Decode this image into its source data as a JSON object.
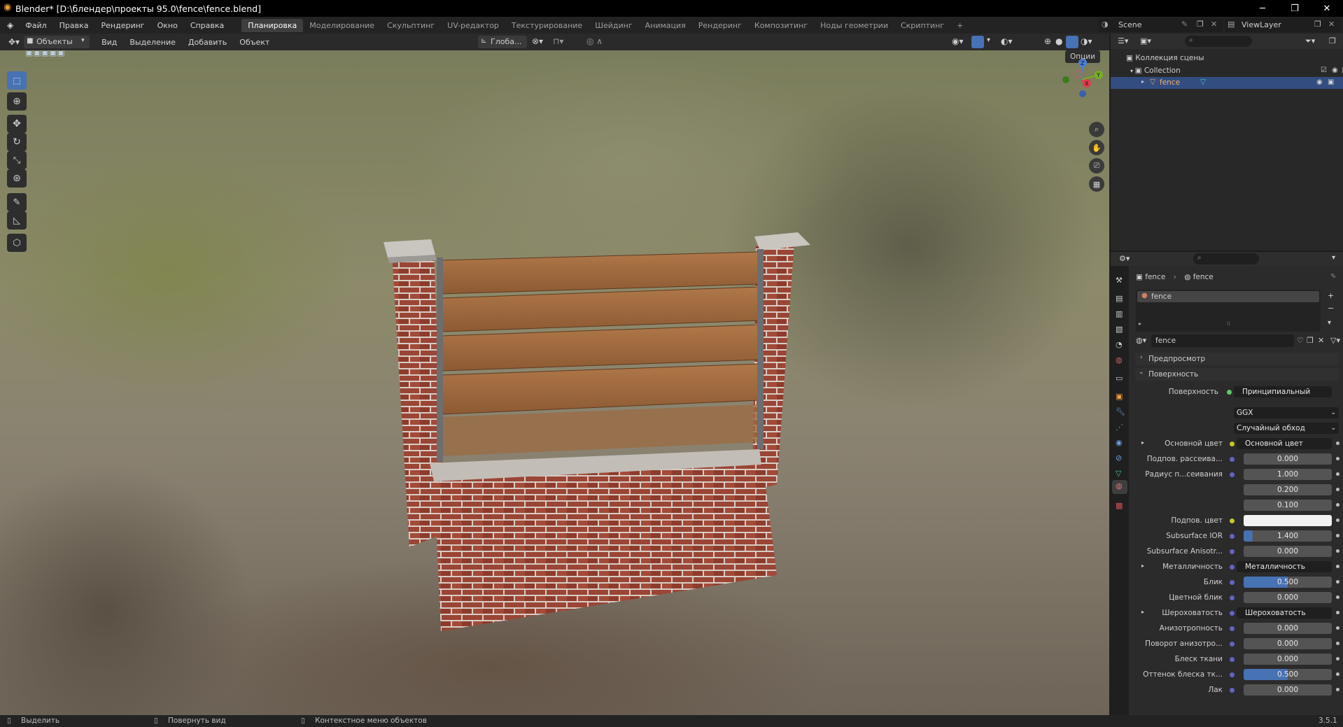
{
  "window": {
    "title": "Blender* [D:\\блендер\\проекты 95.0\\fence\\fence.blend]",
    "minimize": "─",
    "maximize": "❐",
    "close": "✕"
  },
  "menu": [
    "Файл",
    "Правка",
    "Рендеринг",
    "Окно",
    "Справка"
  ],
  "workspaces": [
    "Планировка",
    "Моделирование",
    "Скульптинг",
    "UV-редактор",
    "Текстурирование",
    "Шейдинг",
    "Анимация",
    "Рендеринг",
    "Композитинг",
    "Ноды геометрии",
    "Скриптинг",
    "+"
  ],
  "active_workspace": "Планировка",
  "scene": {
    "name": "Scene",
    "view_layer": "ViewLayer"
  },
  "viewport_header": {
    "mode": "Объекты",
    "menus": [
      "Вид",
      "Выделение",
      "Добавить",
      "Объект"
    ],
    "orientation": "Глоба...",
    "options": "Опции"
  },
  "gizmo": {
    "x": "X",
    "y": "Y",
    "z": "Z"
  },
  "outliner": {
    "root": "Коллекция сцены",
    "collection": "Collection",
    "object": "fence"
  },
  "properties": {
    "breadcrumb": [
      "fence",
      "fence"
    ],
    "material_slot": "fence",
    "material_name": "fence",
    "panels": {
      "preview": "Предпросмотр",
      "surface": "Поверхность"
    },
    "surface_shader": {
      "label": "Поверхность",
      "value": "Принципиальный BSDF"
    },
    "distribution": "GGX",
    "subsurface_method": "Случайный обход",
    "rows": [
      {
        "label": "Основной цвет",
        "value": "Основной цвет",
        "type": "socket",
        "dot": "y",
        "expand": true
      },
      {
        "label": "Подпов. рассеива...",
        "value": "0.000",
        "type": "num",
        "dot": "b"
      },
      {
        "label": "Радиус п...сеивания",
        "value": "1.000",
        "type": "num",
        "dot": "b"
      },
      {
        "label": "",
        "value": "0.200",
        "type": "num"
      },
      {
        "label": "",
        "value": "0.100",
        "type": "num"
      },
      {
        "label": "Подпов. цвет",
        "value": "",
        "type": "color",
        "dot": "y"
      },
      {
        "label": "Subsurface IOR",
        "value": "1.400",
        "type": "num",
        "dot": "b",
        "fill": 0.1
      },
      {
        "label": "Subsurface Anisotr...",
        "value": "0.000",
        "type": "num",
        "dot": "b"
      },
      {
        "label": "Металличность",
        "value": "Металличность",
        "type": "socket",
        "dot": "b",
        "expand": true
      },
      {
        "label": "Блик",
        "value": "0.500",
        "type": "num",
        "dot": "b",
        "fill": 0.5
      },
      {
        "label": "Цветной блик",
        "value": "0.000",
        "type": "num",
        "dot": "b"
      },
      {
        "label": "Шероховатость",
        "value": "Шероховатость",
        "type": "socket",
        "dot": "b",
        "expand": true
      },
      {
        "label": "Анизотропность",
        "value": "0.000",
        "type": "num",
        "dot": "b"
      },
      {
        "label": "Поворот анизотро...",
        "value": "0.000",
        "type": "num",
        "dot": "b"
      },
      {
        "label": "Блеск ткани",
        "value": "0.000",
        "type": "num",
        "dot": "b"
      },
      {
        "label": "Оттенок блеска тк...",
        "value": "0.500",
        "type": "num",
        "dot": "b",
        "fill": 0.5
      },
      {
        "label": "Лак",
        "value": "0.000",
        "type": "num",
        "dot": "b"
      }
    ]
  },
  "statusbar": {
    "select": "Выделить",
    "rotate": "Повернуть вид",
    "context": "Контекстное меню объектов",
    "version": "3.5.1"
  },
  "colors": {
    "accent": "#4772b3",
    "selection": "#334d80",
    "bg": "#2b2b2b"
  }
}
